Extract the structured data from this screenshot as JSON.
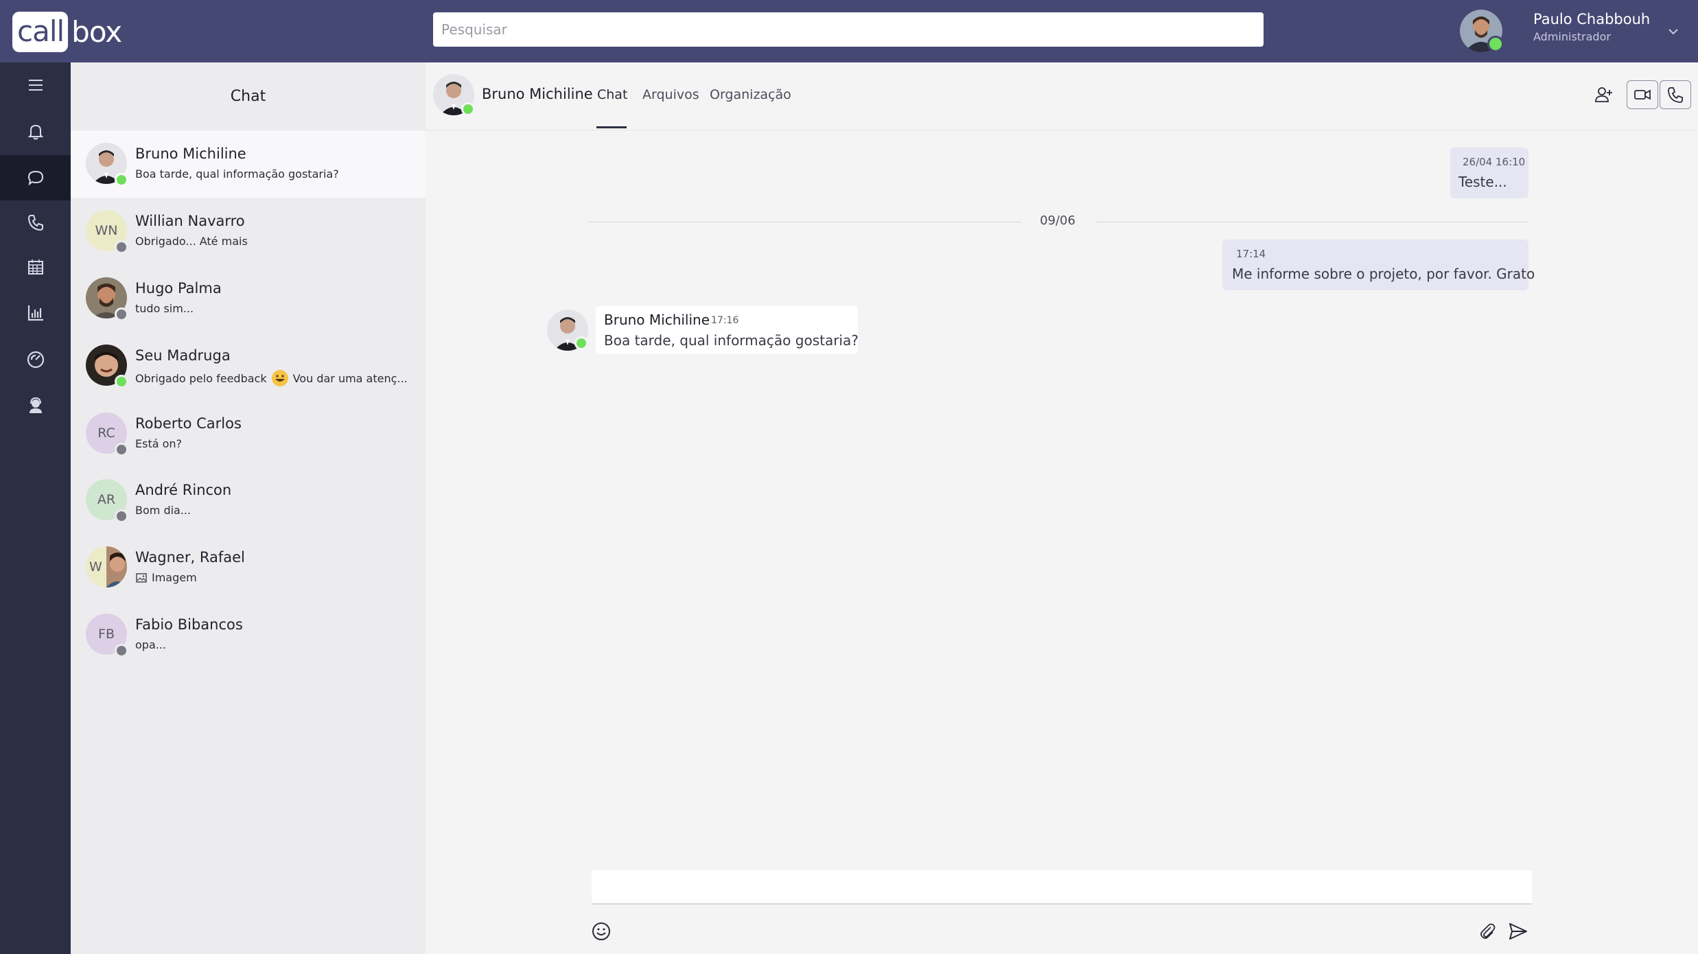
{
  "app": {
    "logo_call": "call",
    "logo_box": "box"
  },
  "search": {
    "placeholder": "Pesquisar"
  },
  "user": {
    "name": "Paulo Chabbouh",
    "role": "Administrador",
    "status": "online"
  },
  "nav": {
    "items": [
      {
        "icon": "menu-icon"
      },
      {
        "icon": "bell-icon"
      },
      {
        "icon": "chat-icon",
        "active": true
      },
      {
        "icon": "phone-icon"
      },
      {
        "icon": "calendar-icon"
      },
      {
        "icon": "bar-chart-icon"
      },
      {
        "icon": "dashboard-gauge-icon"
      },
      {
        "icon": "agent-headset-icon"
      }
    ]
  },
  "chatlist": {
    "title": "Chat",
    "contacts": [
      {
        "name": "Bruno Michiline",
        "last_message": "Boa tarde, qual informação gostaria?",
        "status": "online",
        "avatar": "photo"
      },
      {
        "name": "Willian Navarro",
        "last_message": "Obrigado... Até mais",
        "status": "offline",
        "initials": "WN"
      },
      {
        "name": "Hugo Palma",
        "last_message": "tudo sim...",
        "status": "offline",
        "avatar": "photo"
      },
      {
        "name": "Seu Madruga",
        "last_message": "Obrigado pelo feedback",
        "last_message_after_emoji": "Vou dar uma atenç...",
        "status": "online",
        "avatar": "photo",
        "emoji": "😀"
      },
      {
        "name": "Roberto Carlos",
        "last_message": "Está on?",
        "status": "offline",
        "initials": "RC"
      },
      {
        "name": "André Rincon",
        "last_message": "Bom dia...",
        "status": "offline",
        "initials": "AR"
      },
      {
        "name": "Wagner, Rafael",
        "last_message": "Imagem",
        "status": "none",
        "initials": "W",
        "group": true
      },
      {
        "name": "Fabio Bibancos",
        "last_message": "opa...",
        "status": "offline",
        "initials": "FB"
      }
    ]
  },
  "conversation": {
    "contact_name": "Bruno Michiline",
    "tabs": [
      {
        "label": "Chat",
        "active": true
      },
      {
        "label": "Arquivos"
      },
      {
        "label": "Organização"
      }
    ],
    "messages": [
      {
        "direction": "out",
        "time": "26/04 16:10",
        "text": "Teste..."
      },
      {
        "divider": "09/06"
      },
      {
        "direction": "out",
        "time": "17:14",
        "text": "Me informe sobre o projeto, por favor. Grato"
      },
      {
        "direction": "in",
        "sender": "Bruno Michiline",
        "time": "17:16",
        "text": "Boa tarde, qual informação gostaria?"
      }
    ]
  },
  "colors": {
    "topbar": "#464874",
    "leftnav": "#2c2e44",
    "online": "#6ee05a",
    "offline": "#7a7a82"
  }
}
